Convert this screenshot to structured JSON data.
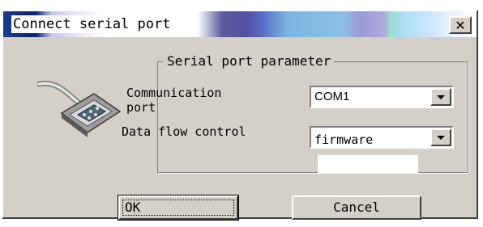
{
  "window": {
    "title": "Connect serial port",
    "close_label": "✕"
  },
  "group": {
    "legend": "Serial port parameter"
  },
  "fields": {
    "communication_port": {
      "label_line1": "Communication",
      "label_line2": "port",
      "value": "COM1"
    },
    "data_flow_control": {
      "label": "Data flow control",
      "value": "firmware"
    }
  },
  "buttons": {
    "ok": "OK",
    "cancel": "Cancel"
  },
  "icons": {
    "connector": "serial-connector-icon",
    "close": "close-icon",
    "dropdown": "chevron-down-icon"
  }
}
